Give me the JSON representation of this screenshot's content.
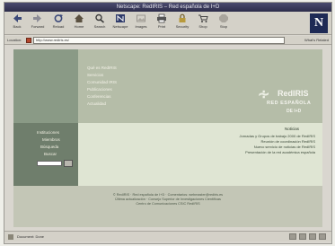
{
  "window": {
    "title": "Netscape: RedIRIS – Red española de I+D"
  },
  "toolbar": {
    "buttons": [
      {
        "label": "Back",
        "icon": "back-arrow-icon"
      },
      {
        "label": "Forward",
        "icon": "forward-arrow-icon"
      },
      {
        "label": "Reload",
        "icon": "reload-icon"
      },
      {
        "label": "Home",
        "icon": "home-icon"
      },
      {
        "label": "Search",
        "icon": "search-icon"
      },
      {
        "label": "Netscape",
        "icon": "netscape-icon"
      },
      {
        "label": "Images",
        "icon": "images-icon"
      },
      {
        "label": "Print",
        "icon": "print-icon"
      },
      {
        "label": "Security",
        "icon": "lock-icon"
      },
      {
        "label": "Shop",
        "icon": "shop-icon"
      },
      {
        "label": "Stop",
        "icon": "stop-icon"
      }
    ],
    "brand_letter": "N"
  },
  "location": {
    "label": "Location:",
    "url": "http://www.rediris.es/",
    "related_label": "What's Related"
  },
  "page": {
    "nav": [
      "Qué es RedIRIS",
      "Servicios",
      "Comunidad IRIS",
      "Publicaciones",
      "Conferencias",
      "Actualidad"
    ],
    "logo": {
      "mark": "∻",
      "name": "RedIRIS",
      "line1": "RED ESPAÑOLA",
      "line2": "DE I+D"
    },
    "side_links": [
      "Instituciones",
      "Miembros",
      "Búsqueda",
      "Buscar"
    ],
    "news": {
      "heading": "Noticias",
      "items": [
        "Jornadas y Grupos de trabajo 2000 de RedIRIS",
        "Reunión de coordinación RedIRIS",
        "Nuevo servicio de noticias de RedIRIS",
        "Presentación de la red académica española"
      ]
    },
    "footer": [
      "© RedIRIS · Red española de I+D · Comentarios: webmaster@rediris.es",
      "Última actualización · Consejo Superior de Investigaciones Científicas",
      "Centro de Comunicaciones CSIC RedIRIS"
    ]
  },
  "status": {
    "text": "Document: Done"
  },
  "colors": {
    "left_column": "#8a9a86",
    "header_band": "#b5bda8",
    "news_panel": "#dfe5d3"
  }
}
